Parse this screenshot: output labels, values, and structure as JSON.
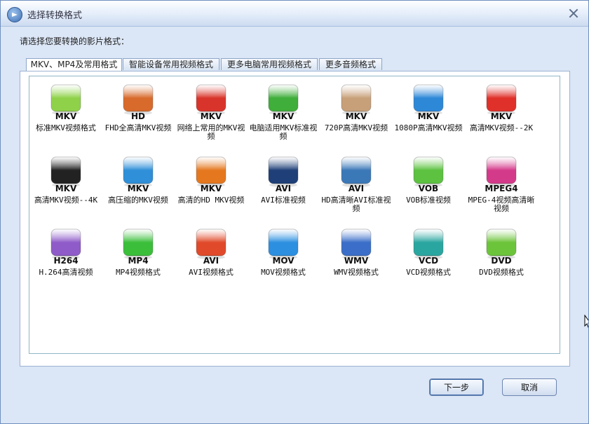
{
  "window": {
    "title": "选择转换格式",
    "close_icon": "close-icon"
  },
  "prompt": "请选择您要转换的影片格式：",
  "tabs": [
    {
      "label": "MKV、MP4及常用格式",
      "active": true
    },
    {
      "label": "智能设备常用视频格式",
      "active": false
    },
    {
      "label": "更多电脑常用视频格式",
      "active": false
    },
    {
      "label": "更多音频格式",
      "active": false
    }
  ],
  "formats": [
    {
      "fmt": "MKV",
      "caption": "标准MKV视频格式",
      "icon": "green-box-icon",
      "color": "#8fd24a"
    },
    {
      "fmt": "HD",
      "caption": "FHD全高清MKV视频",
      "icon": "tv-screens-icon",
      "color": "#d86a2c"
    },
    {
      "fmt": "MKV",
      "caption": "网络上常用的MKV视频",
      "icon": "film-reel-icon",
      "color": "#d9342b"
    },
    {
      "fmt": "MKV",
      "caption": "电脑适用MKV标准视频",
      "icon": "green-leaf-icon",
      "color": "#3fae3a"
    },
    {
      "fmt": "MKV",
      "caption": "720P高清MKV视频",
      "icon": "phone-icon",
      "color": "#c7a07a"
    },
    {
      "fmt": "MKV",
      "caption": "1080P高清MKV视频",
      "icon": "gift-box-icon",
      "color": "#2e88d8"
    },
    {
      "fmt": "MKV",
      "caption": "高清MKV视频--2K",
      "icon": "red-play-icon",
      "color": "#e0302a"
    },
    {
      "fmt": "MKV",
      "caption": "高清MKV视频--4K",
      "icon": "black-reel-icon",
      "color": "#222222"
    },
    {
      "fmt": "MKV",
      "caption": "高压缩的MKV视频",
      "icon": "blue-clock-icon",
      "color": "#2f8fd8"
    },
    {
      "fmt": "MKV",
      "caption": "高清的HD MKV视频",
      "icon": "orange-player-icon",
      "color": "#e5781f"
    },
    {
      "fmt": "AVI",
      "caption": "AVI标准视频",
      "icon": "monitor-icon",
      "color": "#1e3f78"
    },
    {
      "fmt": "AVI",
      "caption": "HD高清晰AVI标准视频",
      "icon": "globe-icon",
      "color": "#3b78b8"
    },
    {
      "fmt": "VOB",
      "caption": "VOB标准视频",
      "icon": "green-disc-icon",
      "color": "#5cc240"
    },
    {
      "fmt": "MPEG4",
      "caption": "MPEG-4视频高清晰视频",
      "icon": "screen-icon",
      "color": "#d43a8a"
    },
    {
      "fmt": "H264",
      "caption": "H.264高清视频",
      "icon": "purple-lens-icon",
      "color": "#8e5bc8"
    },
    {
      "fmt": "MP4",
      "caption": "MP4视频格式",
      "icon": "green-orb-icon",
      "color": "#3bbf3b"
    },
    {
      "fmt": "AVI",
      "caption": "AVI视频格式",
      "icon": "popcorn-icon",
      "color": "#e04a2a"
    },
    {
      "fmt": "MOV",
      "caption": "MOV视频格式",
      "icon": "quicktime-icon",
      "color": "#2c8fe0"
    },
    {
      "fmt": "WMV",
      "caption": "WMV视频格式",
      "icon": "windows-screen-icon",
      "color": "#3a6ec8"
    },
    {
      "fmt": "VCD",
      "caption": "VCD视频格式",
      "icon": "teal-box-icon",
      "color": "#2aa6a0"
    },
    {
      "fmt": "DVD",
      "caption": "DVD视频格式",
      "icon": "green-dvd-icon",
      "color": "#6cc43a"
    }
  ],
  "buttons": {
    "next": "下一步",
    "cancel": "取消"
  }
}
